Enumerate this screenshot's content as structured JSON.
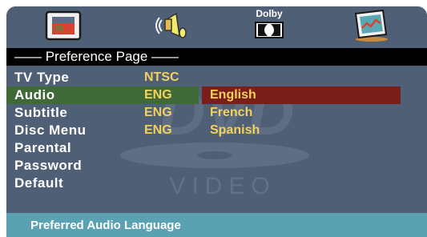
{
  "icons": [
    "tv-icon",
    "speaker-icon",
    "dolby-icon",
    "preference-icon"
  ],
  "dolby_label": "Dolby",
  "page_title": "—— Preference Page ——",
  "watermark_text": "VIDEO",
  "menu": [
    {
      "label": "TV Type",
      "value": "NTSC"
    },
    {
      "label": "Audio",
      "value": "ENG"
    },
    {
      "label": "Subtitle",
      "value": "ENG"
    },
    {
      "label": "Disc Menu",
      "value": "ENG"
    },
    {
      "label": "Parental",
      "value": ""
    },
    {
      "label": "Password",
      "value": ""
    },
    {
      "label": "Default",
      "value": ""
    }
  ],
  "selected_menu": "Audio",
  "options": [
    "English",
    "French",
    "Spanish"
  ],
  "selected_option": "English",
  "status_text": "Preferred Audio Language",
  "colors": {
    "background": "#4f5f76",
    "selected_row": "#3f6a37",
    "selected_option": "#7a1e1c",
    "value_text": "#f2d25b",
    "status_bar": "#5aa2b2"
  }
}
